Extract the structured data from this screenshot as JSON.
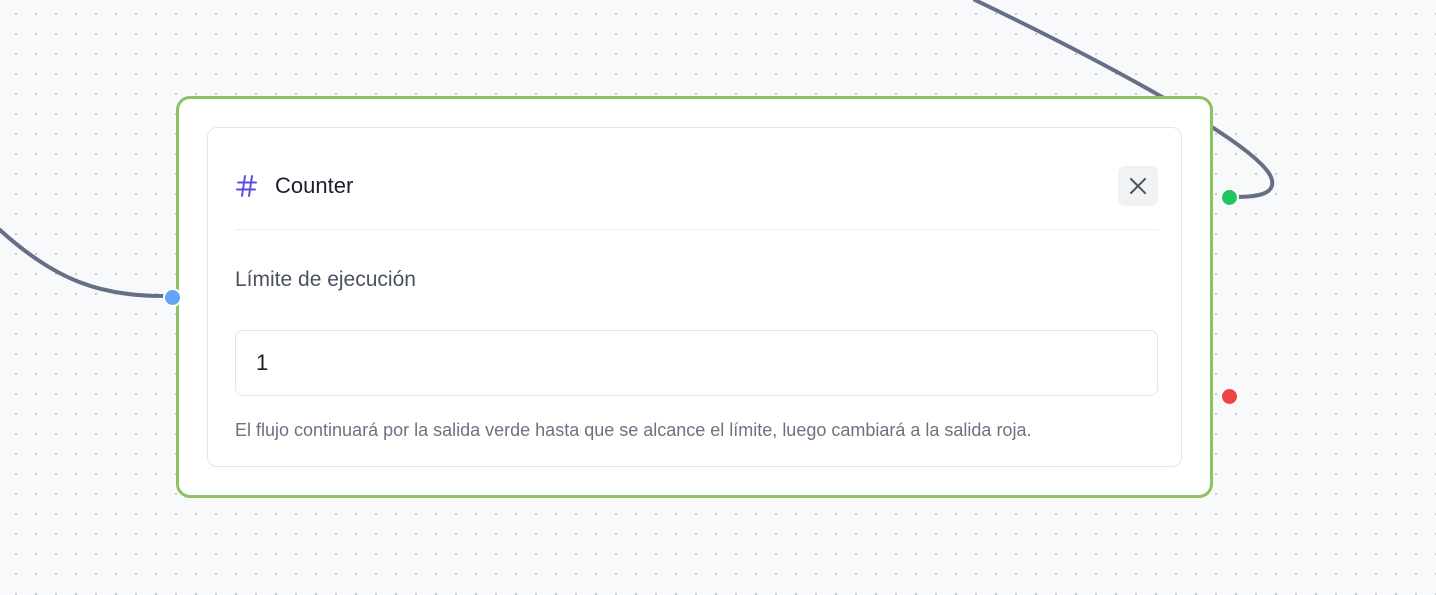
{
  "node": {
    "title": "Counter",
    "icon": "hash-icon",
    "close_icon": "close-icon",
    "field_label": "Límite de ejecución",
    "limit_value": "1",
    "help_text": "El flujo continuará por la salida verde hasta que se alcance el límite, luego cambiará a la salida roja."
  },
  "colors": {
    "node_border": "#8cc263",
    "icon_accent": "#5b4fe0",
    "edge": "#667085",
    "input_handle": "#60a5fa",
    "success_handle": "#22c55e",
    "limit_handle": "#ef4444"
  }
}
